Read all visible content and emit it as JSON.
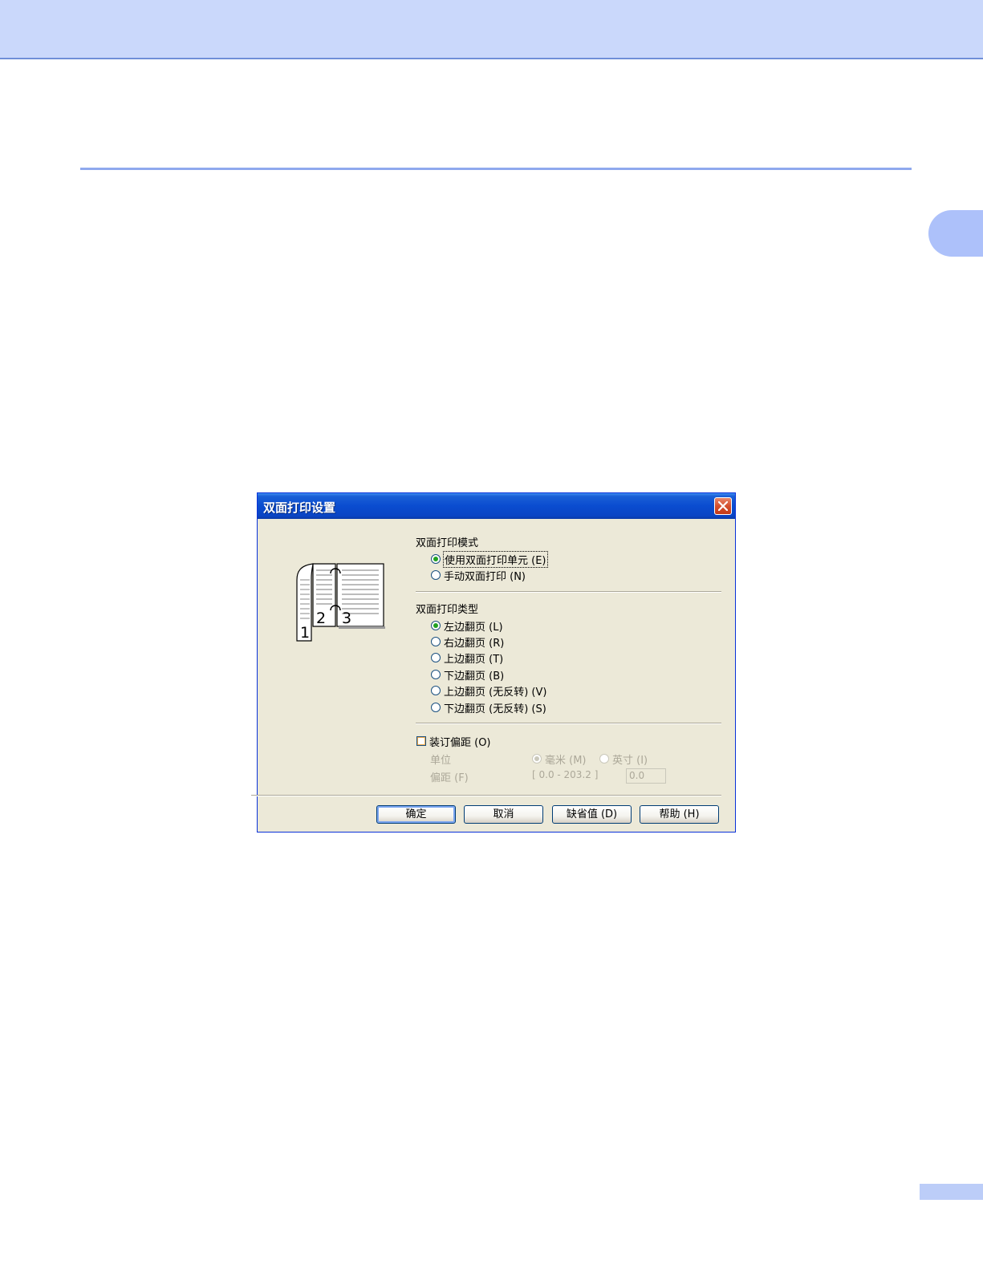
{
  "dialog": {
    "title": "双面打印设置",
    "mode": {
      "label": "双面打印模式",
      "options": [
        {
          "label": "使用双面打印单元 (E)",
          "selected": true
        },
        {
          "label": "手动双面打印 (N)",
          "selected": false
        }
      ]
    },
    "type": {
      "label": "双面打印类型",
      "options": [
        {
          "label": "左边翻页 (L)",
          "selected": true
        },
        {
          "label": "右边翻页 (R)",
          "selected": false
        },
        {
          "label": "上边翻页 (T)",
          "selected": false
        },
        {
          "label": "下边翻页 (B)",
          "selected": false
        },
        {
          "label": "上边翻页 (无反转) (V)",
          "selected": false
        },
        {
          "label": "下边翻页 (无反转) (S)",
          "selected": false
        }
      ]
    },
    "binding": {
      "checkbox_label": "装订偏距 (O)",
      "checked": false,
      "unit_label": "单位",
      "unit_mm": "毫米 (M)",
      "unit_inch": "英寸 (I)",
      "offset_label": "偏距 (F)",
      "range": "[ 0.0 - 203.2 ]",
      "offset_value": "0.0"
    },
    "illustration": {
      "page_left": "2",
      "page_right": "3",
      "page_front": "1"
    },
    "buttons": {
      "ok": "确定",
      "cancel": "取消",
      "default": "缺省值 (D)",
      "help": "帮助 (H)"
    }
  },
  "colors": {
    "header_band": "#cad8fb",
    "accent_rule": "#8fa9ee",
    "dialog_face": "#ece9d8",
    "titlebar_blue": "#0a4cd0",
    "radio_dot": "#21a121"
  }
}
